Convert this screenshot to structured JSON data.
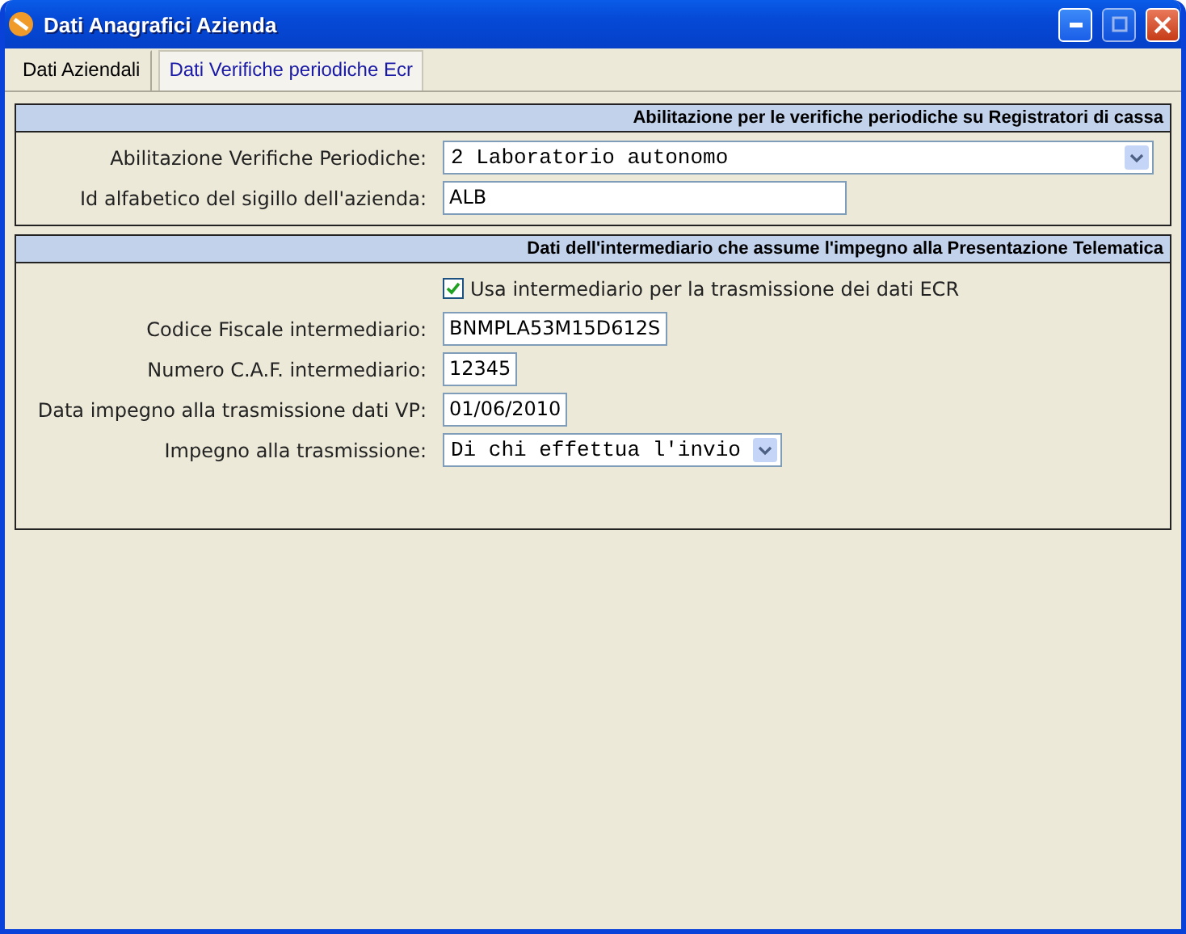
{
  "window": {
    "title": "Dati Anagrafici Azienda"
  },
  "tabs": [
    {
      "label": "Dati Aziendali",
      "selected": false
    },
    {
      "label": "Dati Verifiche periodiche Ecr",
      "selected": true
    }
  ],
  "sections": [
    {
      "title": "Abilitazione per le verifiche periodiche su Registratori di cassa",
      "rows": [
        {
          "kind": "select",
          "label": "Abilitazione Verifiche Periodiche:",
          "value": "2 Laboratorio autonomo"
        },
        {
          "kind": "text",
          "label": "Id alfabetico del sigillo dell'azienda:",
          "value": "ALB"
        }
      ]
    },
    {
      "title": "Dati dell'intermediario che assume l'impegno alla Presentazione Telematica",
      "rows": [
        {
          "kind": "checkbox",
          "label": "Usa intermediario per la trasmissione dei dati ECR",
          "checked": true
        },
        {
          "kind": "text",
          "label": "Codice Fiscale intermediario:",
          "value": "BNMPLA53M15D612S"
        },
        {
          "kind": "text",
          "label": "Numero C.A.F. intermediario:",
          "value": "12345"
        },
        {
          "kind": "text",
          "label": "Data impegno alla trasmissione dati VP:",
          "value": "01/06/2010"
        },
        {
          "kind": "select",
          "label": "Impegno alla trasmissione:",
          "value": "Di chi effettua l'invio"
        }
      ]
    }
  ]
}
